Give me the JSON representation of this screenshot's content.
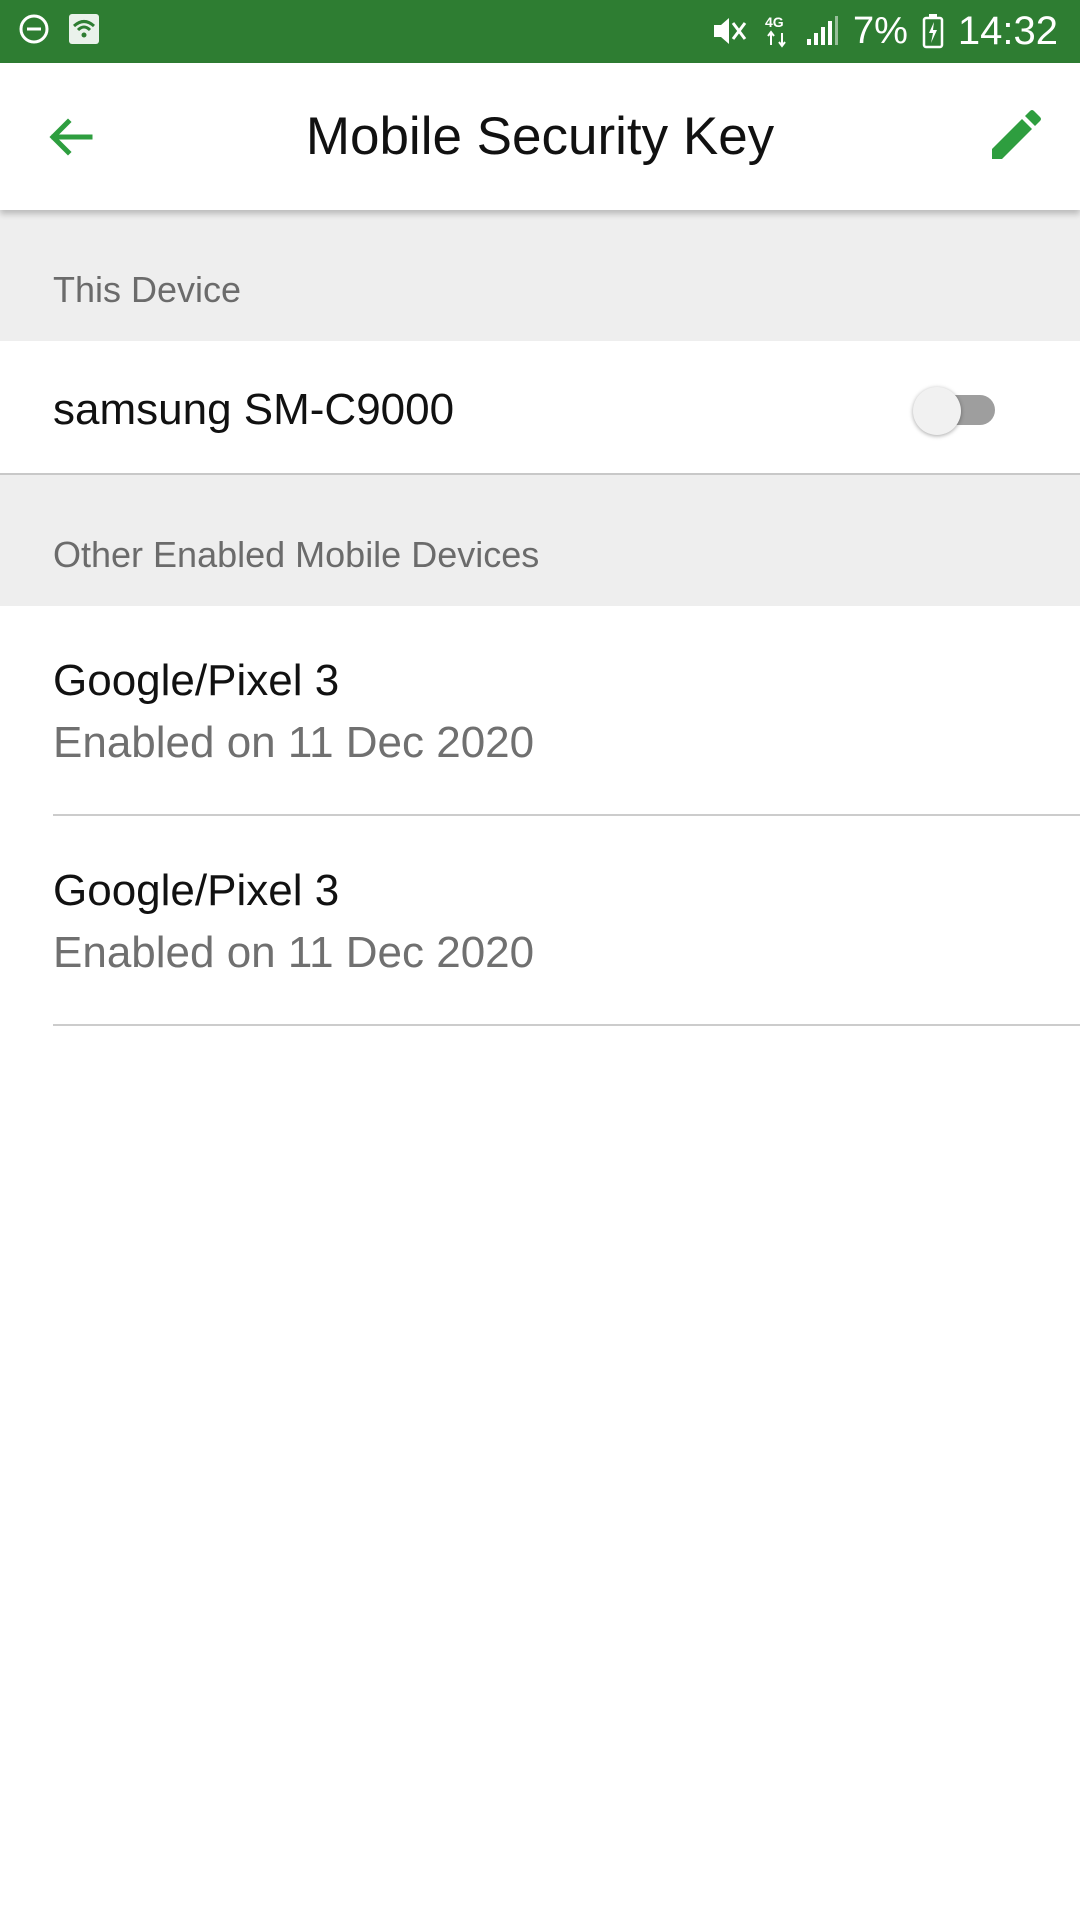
{
  "status_bar": {
    "left_icons": [
      "do-not-disturb-icon",
      "wifi-icon"
    ],
    "right_icons": [
      "mute-icon",
      "4g-data-icon",
      "signal-icon",
      "battery-charging-icon"
    ],
    "battery_text": "7%",
    "time": "14:32",
    "background_color": "#2e7d32"
  },
  "toolbar": {
    "title": "Mobile Security Key",
    "back_icon": "arrow-left-icon",
    "edit_icon": "pencil-icon",
    "accent_color": "#2e9e3f"
  },
  "this_device_section": {
    "header": "This Device",
    "device_name": "samsung SM-C9000",
    "toggle_on": false
  },
  "other_devices_section": {
    "header": "Other Enabled Mobile Devices",
    "items": [
      {
        "name": "Google/Pixel 3",
        "subtitle": "Enabled on 11 Dec 2020"
      },
      {
        "name": "Google/Pixel 3",
        "subtitle": "Enabled on 11 Dec 2020"
      }
    ]
  }
}
